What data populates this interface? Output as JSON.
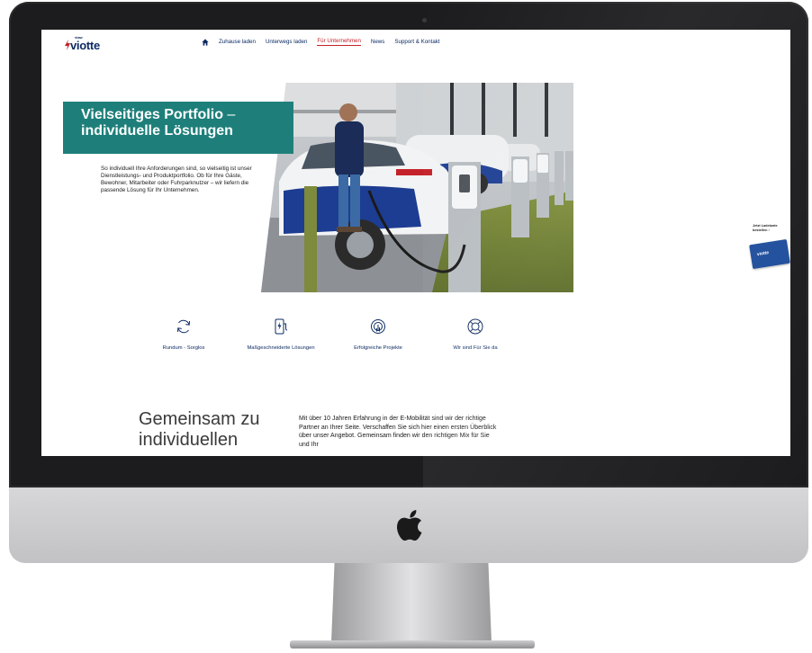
{
  "brand": {
    "logo_tag": "viaw",
    "logo_word": "viotte",
    "primary_color": "#0d2b63",
    "accent_color": "#c4222a",
    "teal_color": "#1e7f7a"
  },
  "nav": {
    "items": [
      {
        "label": "Zuhause laden",
        "active": false
      },
      {
        "label": "Unterwegs laden",
        "active": false
      },
      {
        "label": "Für Unternehmen",
        "active": true
      },
      {
        "label": "News",
        "active": false
      },
      {
        "label": "Support & Kontakt",
        "active": false
      }
    ]
  },
  "hero": {
    "title_line1": "Vielseitiges Portfolio",
    "title_dash": " –",
    "title_line2": "individuelle Lösungen",
    "text": "So individuell Ihre Anforderungen sind, so vielseitig ist unser Dienstleistungs- und Produktportfolio. Ob für Ihre Gäste, Bewohner, Mitarbeiter oder Fuhrparknutzer – wir liefern die passende Lösung für Ihr Unternehmen."
  },
  "features": [
    {
      "label": "Rundum - Sorglos",
      "icon": "refresh-icon"
    },
    {
      "label": "Maßgeschneiderte Lösungen",
      "icon": "charging-station-icon"
    },
    {
      "label": "Erfolgreiche Projekte",
      "icon": "touch-icon"
    },
    {
      "label": "Wir sind Für Sie da",
      "icon": "lifebuoy-icon"
    }
  ],
  "section": {
    "title": "Gemeinsam zu individuellen",
    "text": "Mit über 10 Jahren Erfahrung in der E-Mobilität sind wir der richtige Partner an Ihrer Seite. Verschaffen Sie sich hier einen ersten Überblick über unser Angebot. Gemeinsam finden wir den richtigen Mix für Sie und Ihr"
  },
  "side_card": {
    "text": "Jetzt Ladekarte bestellen ›",
    "card_word": "viotte"
  }
}
